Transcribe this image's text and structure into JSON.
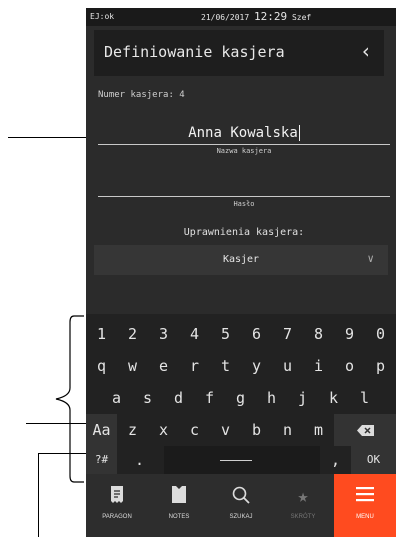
{
  "status": {
    "left": "EJ:ok",
    "date": "21/06/2017",
    "time": "12:29",
    "user": "Szef"
  },
  "header": {
    "title": "Definiowanie kasjera",
    "back_icon": "chevron-left"
  },
  "form": {
    "number_label": "Numer kasjera: 4",
    "name_value": "Anna Kowalska",
    "name_label": "Nazwa kasjera",
    "password_value": "",
    "password_label": "Hasło",
    "permissions_label": "Uprawnienia kasjera:",
    "permissions_value": "Kasjer"
  },
  "keyboard": {
    "digits": [
      "1",
      "2",
      "3",
      "4",
      "5",
      "6",
      "7",
      "8",
      "9",
      "0"
    ],
    "row1": [
      "q",
      "w",
      "e",
      "r",
      "t",
      "y",
      "u",
      "i",
      "o",
      "p"
    ],
    "row2": [
      "a",
      "s",
      "d",
      "f",
      "g",
      "h",
      "j",
      "k",
      "l"
    ],
    "row3": [
      "z",
      "x",
      "c",
      "v",
      "b",
      "n",
      "m"
    ],
    "shift_label": "Aa",
    "symbols_label": "?#",
    "dot": ".",
    "comma": ",",
    "ok_label": "OK"
  },
  "nav": [
    {
      "label": "PARAGON",
      "icon": "receipt-icon"
    },
    {
      "label": "NOTES",
      "icon": "notes-icon"
    },
    {
      "label": "SZUKAJ",
      "icon": "search-icon"
    },
    {
      "label": "SKRÓTY",
      "icon": "star-icon"
    },
    {
      "label": "MENU",
      "icon": "menu-icon"
    }
  ],
  "colors": {
    "accent": "#ff4b1f",
    "background": "#2b2b2b"
  }
}
